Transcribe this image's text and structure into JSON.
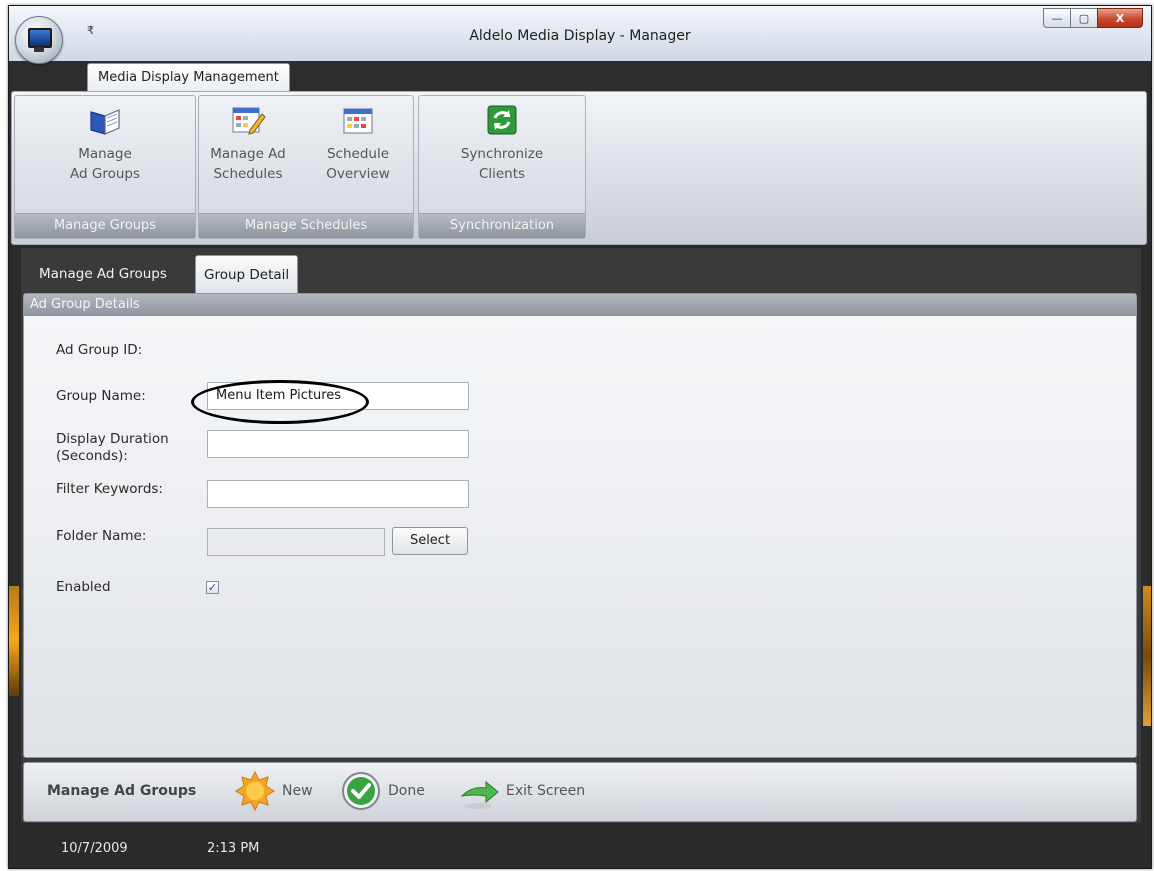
{
  "window": {
    "title": "Aldelo Media Display - Manager",
    "qat_symbol": "₹",
    "controls": {
      "minimize": "—",
      "maximize": "▢",
      "close": "X"
    }
  },
  "ribbon": {
    "tab_label": "Media Display Management",
    "groups": [
      {
        "label": "Manage Groups",
        "buttons": [
          {
            "line1": "Manage",
            "line2": "Ad Groups",
            "icon": "open-book-icon"
          }
        ]
      },
      {
        "label": "Manage Schedules",
        "buttons": [
          {
            "line1": "Manage Ad",
            "line2": "Schedules",
            "icon": "calendar-edit-icon"
          },
          {
            "line1": "Schedule",
            "line2": "Overview",
            "icon": "calendar-grid-icon"
          }
        ]
      },
      {
        "label": "Synchronization",
        "buttons": [
          {
            "line1": "Synchronize",
            "line2": "Clients",
            "icon": "sync-icon"
          }
        ]
      }
    ]
  },
  "tabs": [
    {
      "label": "Manage Ad Groups"
    },
    {
      "label": "Group Detail"
    }
  ],
  "panel": {
    "header": "Ad Group Details",
    "fields": {
      "ad_group_id": {
        "label": "Ad Group ID:",
        "value": ""
      },
      "group_name": {
        "label": "Group Name:",
        "value": "Menu Item Pictures"
      },
      "display_duration": {
        "label_line1": "Display Duration",
        "label_line2": "(Seconds):",
        "value": ""
      },
      "filter_keywords": {
        "label": "Filter Keywords:",
        "value": ""
      },
      "folder_name": {
        "label": "Folder Name:",
        "value": "",
        "button": "Select"
      },
      "enabled": {
        "label": "Enabled",
        "checked": true,
        "check_glyph": "✓"
      }
    }
  },
  "bottom_bar": {
    "title": "Manage Ad Groups",
    "actions": [
      {
        "label": "New",
        "icon": "starburst-icon"
      },
      {
        "label": "Done",
        "icon": "checkmark-circle-icon"
      },
      {
        "label": "Exit Screen",
        "icon": "exit-arrow-icon"
      }
    ]
  },
  "status": {
    "date": "10/7/2009",
    "time": "2:13 PM"
  },
  "colors": {
    "chrome_dark": "#2b2b2b",
    "ribbon_light": "#dfe3e9",
    "accent_green": "#2f9a3c",
    "accent_orange": "#f5a623"
  }
}
